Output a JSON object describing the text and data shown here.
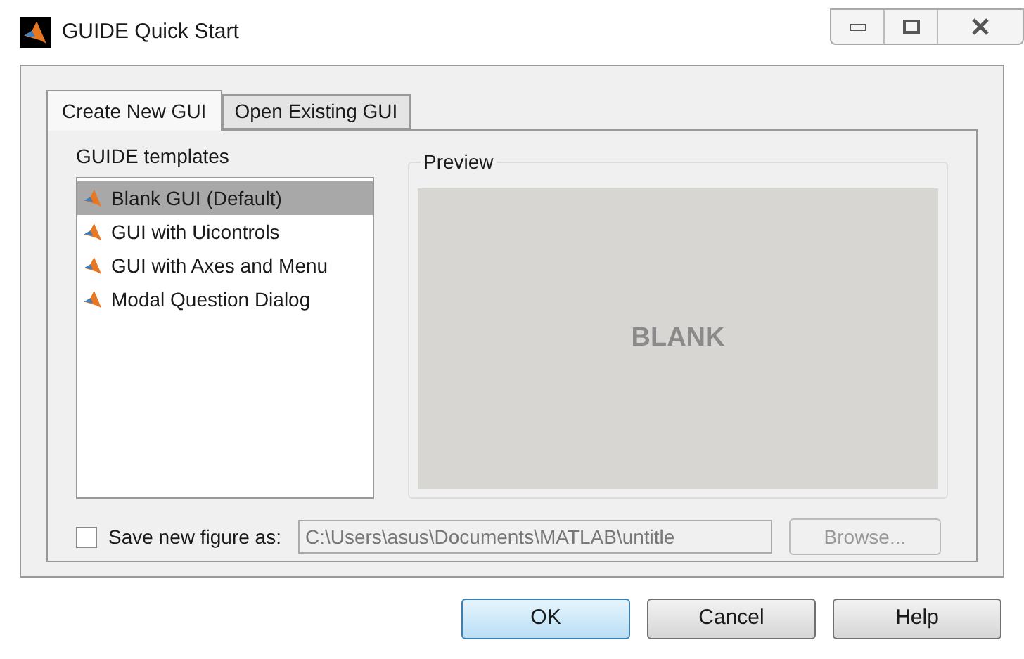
{
  "window": {
    "title": "GUIDE Quick Start"
  },
  "tabs": [
    {
      "label": "Create New GUI",
      "selected": true
    },
    {
      "label": "Open Existing GUI",
      "selected": false
    }
  ],
  "templates": {
    "label": "GUIDE templates",
    "items": [
      {
        "label": "Blank GUI (Default)",
        "selected": true
      },
      {
        "label": "GUI with Uicontrols",
        "selected": false
      },
      {
        "label": "GUI with Axes and Menu",
        "selected": false
      },
      {
        "label": "Modal Question Dialog",
        "selected": false
      }
    ]
  },
  "preview": {
    "label": "Preview",
    "text": "BLANK"
  },
  "save": {
    "label": "Save new figure as:",
    "checked": false,
    "value": "C:\\Users\\asus\\Documents\\MATLAB\\untitle",
    "disabled": true,
    "browse": "Browse..."
  },
  "buttons": [
    {
      "label": "OK",
      "kind": "default"
    },
    {
      "label": "Cancel",
      "kind": "normal"
    },
    {
      "label": "Help",
      "kind": "normal"
    }
  ]
}
